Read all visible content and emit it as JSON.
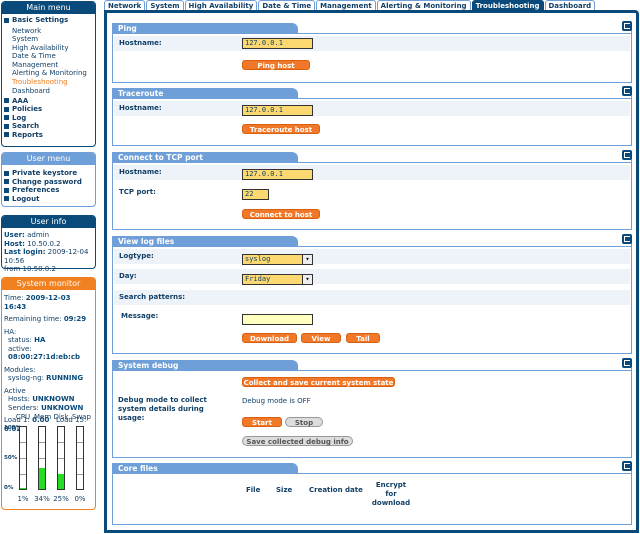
{
  "sidebar": {
    "main_menu": {
      "title": "Main menu",
      "group": "Basic Settings",
      "sub": [
        "Network",
        "System",
        "High Availability",
        "Date & Time",
        "Management",
        "Alerting & Monitoring",
        "Troubleshooting",
        "Dashboard"
      ],
      "others": [
        "AAA",
        "Policies",
        "Log",
        "Search",
        "Reports"
      ]
    },
    "user_menu": {
      "title": "User menu",
      "items": [
        "Private keystore",
        "Change password",
        "Preferences",
        "Logout"
      ]
    },
    "user_info": {
      "title": "User info",
      "user_label": "User:",
      "user": "admin",
      "host_label": "Host:",
      "host": "10.50.0.2",
      "login_label": "Last login:",
      "login": "2009-12-04 10:56",
      "from": "from 10.50.0.2"
    },
    "monitor": {
      "title": "System monitor",
      "time_label": "Time:",
      "time": "2009-12-03 16:43",
      "remaining_label": "Remaining time:",
      "remaining": "09:29",
      "ha_label": "HA:",
      "status_label": "status:",
      "status": "HA",
      "active_label": "active:",
      "active": "08:00:27:1d:eb:cb",
      "modules_label": "Modules:",
      "syslog_label": "syslog-ng:",
      "syslog": "RUNNING",
      "active2_label": "Active",
      "hosts_label": "Hosts:",
      "hosts": "UNKNOWN",
      "senders_label": "Senders:",
      "senders": "UNKNOWN",
      "load1_label": "Load 1:",
      "load1": "0.00",
      "load15_label": "Load 15:",
      "load15": "0.02",
      "scale": [
        "100%",
        "50%",
        "0%"
      ],
      "gauges": [
        {
          "name": "CPU",
          "value": 1,
          "label": "1%"
        },
        {
          "name": "Mem",
          "value": 34,
          "label": "34%"
        },
        {
          "name": "Disk",
          "value": 25,
          "label": "25%"
        },
        {
          "name": "Swap",
          "value": 0,
          "label": "0%"
        }
      ]
    }
  },
  "tabs": [
    "Network",
    "System",
    "High Availability",
    "Date & Time",
    "Management",
    "Alerting & Monitoring",
    "Troubleshooting",
    "Dashboard"
  ],
  "active_tab": 6,
  "ping": {
    "title": "Ping",
    "host_label": "Hostname:",
    "host": "127.0.0.1",
    "button": "Ping host"
  },
  "traceroute": {
    "title": "Traceroute",
    "host_label": "Hostname:",
    "host": "127.0.0.1",
    "button": "Traceroute host"
  },
  "tcp": {
    "title": "Connect to TCP port",
    "host_label": "Hostname:",
    "host": "127.0.0.1",
    "port_label": "TCP port:",
    "port": "22",
    "button": "Connect to host"
  },
  "logs": {
    "title": "View log files",
    "logtype_label": "Logtype:",
    "logtype": "syslog",
    "day_label": "Day:",
    "day": "Friday",
    "patterns_label": "Search patterns:",
    "message_label": "Message:",
    "message": "",
    "buttons": [
      "Download",
      "View",
      "Tail"
    ]
  },
  "debug": {
    "title": "System debug",
    "collect_button": "Collect and save current system state in",
    "mode_label": "Debug mode to collect system details during usage:",
    "mode_status": "Debug mode is OFF",
    "start": "Start",
    "stop": "Stop",
    "save": "Save collected debug info"
  },
  "core": {
    "title": "Core files",
    "columns": [
      "File",
      "Size",
      "Creation date",
      "Encrypt for download"
    ]
  }
}
